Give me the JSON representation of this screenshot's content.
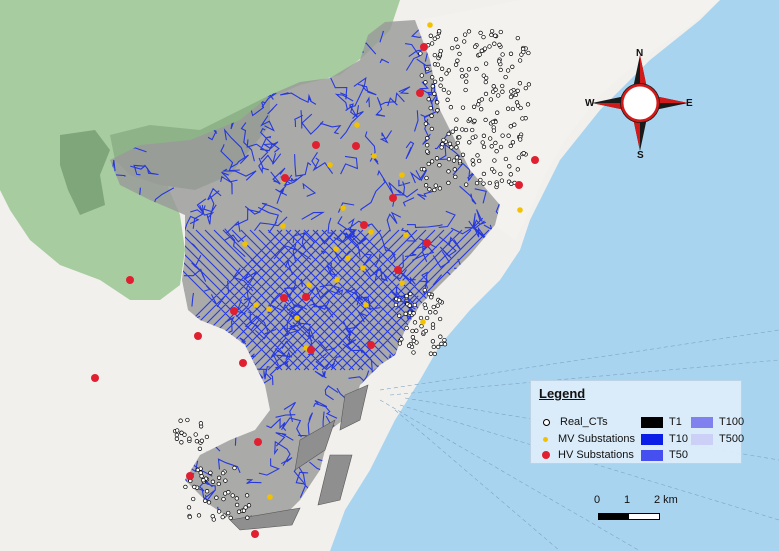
{
  "legend": {
    "title": "Legend",
    "left_items": [
      {
        "symbol": "real-ct",
        "label": "Real_CTs"
      },
      {
        "symbol": "mv-substation",
        "label": "MV Substations"
      },
      {
        "symbol": "hv-substation",
        "label": "HV Substations"
      }
    ],
    "right_items": [
      {
        "label": "T1",
        "color": "#000000"
      },
      {
        "label": "T100",
        "color": "#8080ee"
      },
      {
        "label": "T10",
        "color": "#0a1ee8"
      },
      {
        "label": "T500",
        "color": "#ccd0f6"
      },
      {
        "label": "T50",
        "color": "#4650f0"
      }
    ]
  },
  "scale_bar": {
    "labels": [
      "0",
      "1",
      "2 km"
    ]
  },
  "compass": {
    "n": "N",
    "s": "S",
    "e": "E",
    "w": "W"
  },
  "colors": {
    "sea": "#a8d4f0",
    "land": "#f1f0ec",
    "park_green": "#9fc799",
    "network_area_gray": "#9a9a9a",
    "network_blue": "#1026e6",
    "real_ct": "#ffffff",
    "mv_substation": "#f2c200",
    "hv_substation": "#e02030",
    "compass_red": "#d21a1a"
  }
}
